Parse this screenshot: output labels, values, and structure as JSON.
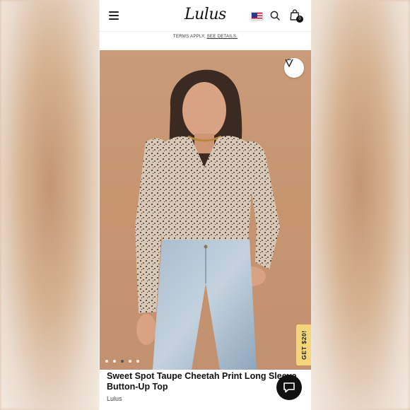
{
  "header": {
    "logo": "Lulus",
    "menu_icon": "hamburger-icon",
    "flag_icon": "us-flag-icon",
    "search_icon": "search-icon",
    "bag_icon": "shopping-bag-icon",
    "bag_count": "0"
  },
  "promo": {
    "terms_text": "TERMS APPLY.",
    "details_link": "SEE DETAILS."
  },
  "carousel": {
    "favorite_icon": "heart-v-icon",
    "get_tab_label": "GET $20!",
    "slide_count": 5,
    "active_slide": 3
  },
  "product": {
    "title": "Sweet Spot Taupe Cheetah Print Long Sleeve Button-Up Top",
    "brand": "Lulus"
  },
  "chat": {
    "icon": "chat-bubble-icon"
  },
  "colors": {
    "background_blur": "#d9b99c",
    "photo_backdrop": "#c99b79",
    "promo_tab": "#f5d57a",
    "text_primary": "#111111"
  }
}
